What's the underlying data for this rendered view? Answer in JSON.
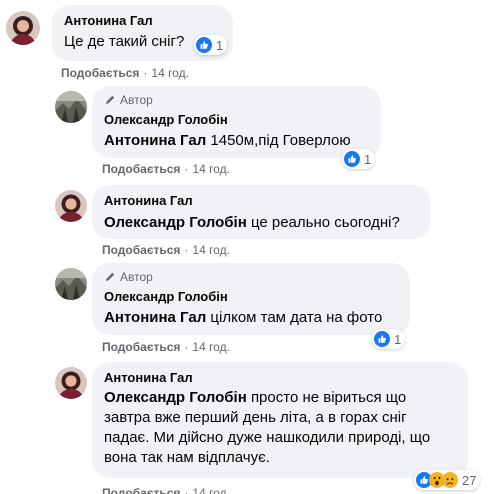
{
  "colors": {
    "like_blue": "#1877f2",
    "bubble_bg": "#f0f2f5",
    "meta_gray": "#65676b"
  },
  "comments": [
    {
      "author": "Антонина Гал",
      "text": "Це де такий сніг?",
      "like_label": "Подобається",
      "time": "14 год.",
      "reaction_count": "1",
      "reactions": [
        "like-icon"
      ]
    },
    {
      "author_badge": "Автор",
      "author": "Олександр Голобін",
      "mention": "Антонина Гал",
      "text": "1450м,під Говерлою",
      "like_label": "Подобається",
      "time": "14 год.",
      "reaction_count": "1",
      "reactions": [
        "like-icon"
      ]
    },
    {
      "author": "Антонина Гал",
      "mention": "Олександр Голобін",
      "text": "це реально сьогодні?",
      "like_label": "Подобається",
      "time": "14 год."
    },
    {
      "author_badge": "Автор",
      "author": "Олександр Голобін",
      "mention": "Антонина Гал",
      "text": "цілком там дата на фото",
      "like_label": "Подобається",
      "time": "14 год.",
      "reaction_count": "1",
      "reactions": [
        "like-icon"
      ]
    },
    {
      "author": "Антонина Гал",
      "mention": "Олександр Голобін",
      "text_line1": "просто не віриться що",
      "text_line2": "завтра вже перший день літа, а в горах сніг",
      "text_line3": "падає. Ми дійсно дуже нашкодили природі, що",
      "text_line4": "вона так нам відплачує.",
      "like_label": "Подобається",
      "time": "14 год.",
      "reaction_count": "27",
      "reactions": [
        "like-icon",
        "wow-icon",
        "sad-icon"
      ]
    }
  ]
}
